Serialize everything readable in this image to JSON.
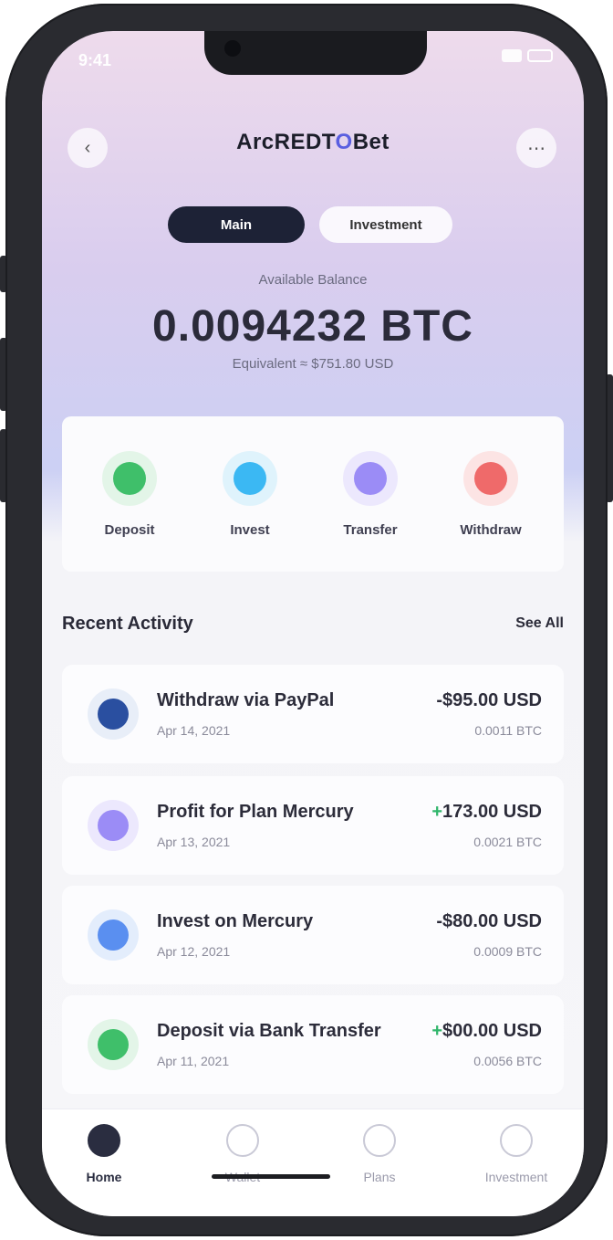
{
  "status": {
    "time": "9:41"
  },
  "header": {
    "title_prefix": "ArcREDT",
    "title_accent": "O",
    "title_suffix": "Bet"
  },
  "tabs": [
    {
      "label": "Main"
    },
    {
      "label": "Investment"
    }
  ],
  "balance": {
    "label": "Available Balance",
    "amount": "0.0094232 BTC",
    "sub": "Equivalent ≈ $751.80 USD"
  },
  "actions": [
    {
      "label": "Deposit",
      "color": "#3fbf6a",
      "bg": "#e3f5e8",
      "icon": "deposit-icon"
    },
    {
      "label": "Invest",
      "color": "#3bb8f3",
      "bg": "#dff3fc",
      "icon": "invest-icon"
    },
    {
      "label": "Transfer",
      "color": "#9b8cf6",
      "bg": "#ece8fd",
      "icon": "transfer-icon"
    },
    {
      "label": "Withdraw",
      "color": "#ef6a6a",
      "bg": "#fce4e4",
      "icon": "withdraw-icon"
    }
  ],
  "activity": {
    "title": "Recent Activity",
    "see_all": "See All",
    "items": [
      {
        "title": "Withdraw via PayPal",
        "date": "Apr 14, 2021",
        "amount": "-$95.00 USD",
        "sign": "",
        "sub": "0.0011 BTC",
        "icon": "paypal-icon",
        "color": "#2a4fa0",
        "bg": "#e8eef8"
      },
      {
        "title": "Profit for Plan Mercury",
        "date": "Apr 13, 2021",
        "amount": "173.00 USD",
        "sign": "+",
        "sub": "0.0021 BTC",
        "icon": "profit-icon",
        "color": "#9b8cf6",
        "bg": "#ece8fd"
      },
      {
        "title": "Invest on Mercury",
        "date": "Apr 12, 2021",
        "amount": "-$80.00 USD",
        "sign": "",
        "sub": "0.0009 BTC",
        "icon": "invest-icon",
        "color": "#5a8ff0",
        "bg": "#e3edfc"
      },
      {
        "title": "Deposit via Bank Transfer",
        "date": "Apr 11, 2021",
        "amount": "$00.00 USD",
        "sign": "+",
        "sub": "0.0056 BTC",
        "icon": "bank-icon",
        "color": "#3fbf6a",
        "bg": "#e3f5e8"
      }
    ]
  },
  "nav": [
    {
      "label": "Home",
      "icon": "home-icon"
    },
    {
      "label": "Wallet",
      "icon": "wallet-icon"
    },
    {
      "label": "Plans",
      "icon": "plans-icon"
    },
    {
      "label": "Investment",
      "icon": "investment-icon"
    }
  ]
}
